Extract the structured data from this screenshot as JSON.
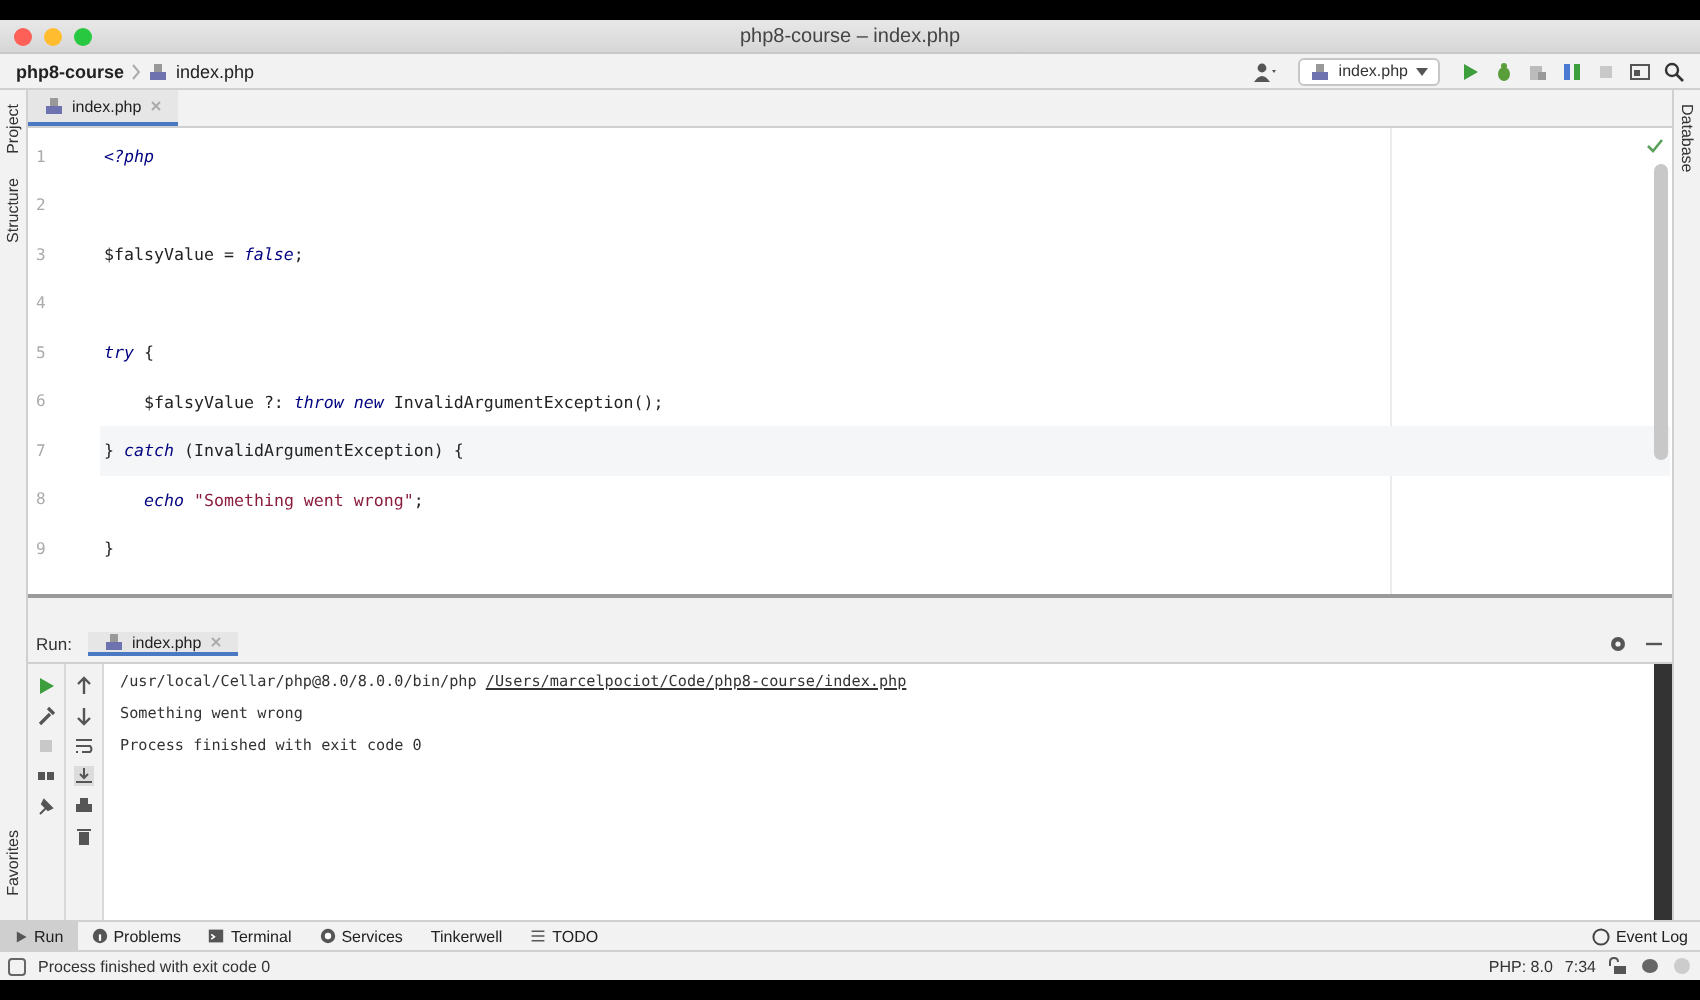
{
  "window": {
    "title": "php8-course – index.php"
  },
  "breadcrumb": [
    {
      "label": "php8-course",
      "kind": "project"
    },
    {
      "label": "index.php",
      "kind": "file"
    }
  ],
  "run_config": {
    "label": "index.php"
  },
  "left_stripe": {
    "top": [
      "Project",
      "Structure"
    ],
    "bottom": [
      "Favorites"
    ]
  },
  "right_stripe": [
    "Database"
  ],
  "editor_tabs": [
    {
      "label": "index.php",
      "selected": true
    }
  ],
  "code_lines": [
    {
      "number": "1",
      "indent": false,
      "current": false,
      "tokens": [
        {
          "text": "<?php",
          "kind": "keyword"
        }
      ]
    },
    {
      "number": "2",
      "current": false
    },
    {
      "number": "3",
      "indent": false,
      "current": false,
      "tokens": [
        {
          "text": "$falsyValue = ",
          "kind": "plain"
        },
        {
          "text": "false",
          "kind": "constant"
        },
        {
          "text": ";",
          "kind": "plain"
        }
      ]
    },
    {
      "number": "4",
      "current": false
    },
    {
      "number": "5",
      "indent": false,
      "current": false,
      "tokens": [
        {
          "text": "try",
          "kind": "keyword"
        },
        {
          "text": " {",
          "kind": "plain"
        }
      ]
    },
    {
      "number": "6",
      "indent": true,
      "current": false,
      "tokens": [
        {
          "text": "$falsyValue ?: ",
          "kind": "plain"
        },
        {
          "text": "throw new",
          "kind": "keyword"
        },
        {
          "text": " InvalidArgumentException();",
          "kind": "plain"
        }
      ]
    },
    {
      "number": "7",
      "indent": false,
      "current": true,
      "tokens": [
        {
          "text": "} ",
          "kind": "plain"
        },
        {
          "text": "catch",
          "kind": "keyword"
        },
        {
          "text": " (InvalidArgumentException) {",
          "kind": "plain"
        }
      ]
    },
    {
      "number": "8",
      "indent": true,
      "current": false,
      "tokens": [
        {
          "text": "echo ",
          "kind": "keyword"
        },
        {
          "text": "\"Something went wrong\"",
          "kind": "string"
        },
        {
          "text": ";",
          "kind": "plain"
        }
      ]
    },
    {
      "number": "9",
      "indent": false,
      "current": false,
      "tokens": [
        {
          "text": "}",
          "kind": "plain"
        }
      ]
    }
  ],
  "run_panel": {
    "label": "Run:",
    "tabs": [
      {
        "label": "index.php",
        "selected": true
      }
    ],
    "output": [
      {
        "kind": "command",
        "text": "/usr/local/Cellar/php@8.0/8.0.0/bin/php ",
        "link": "/Users/marcelpociot/Code/php8-course/index.php"
      },
      {
        "kind": "plain",
        "text": "Something went wrong"
      },
      {
        "kind": "plain",
        "text": "Process finished with exit code 0"
      }
    ]
  },
  "tool_windows": [
    {
      "label": "Run",
      "kind": "run",
      "selected": true
    },
    {
      "label": "Problems",
      "kind": "problems",
      "selected": false
    },
    {
      "label": "Terminal",
      "kind": "terminal",
      "selected": false
    },
    {
      "label": "Services",
      "kind": "services",
      "selected": false
    },
    {
      "label": "Tinkerwell",
      "kind": "plain",
      "selected": false
    },
    {
      "label": "TODO",
      "kind": "todo",
      "selected": false
    }
  ],
  "event_log": "Event Log",
  "status_bar": {
    "message": "Process finished with exit code 0",
    "php": "PHP: 8.0",
    "position": "7:34"
  }
}
